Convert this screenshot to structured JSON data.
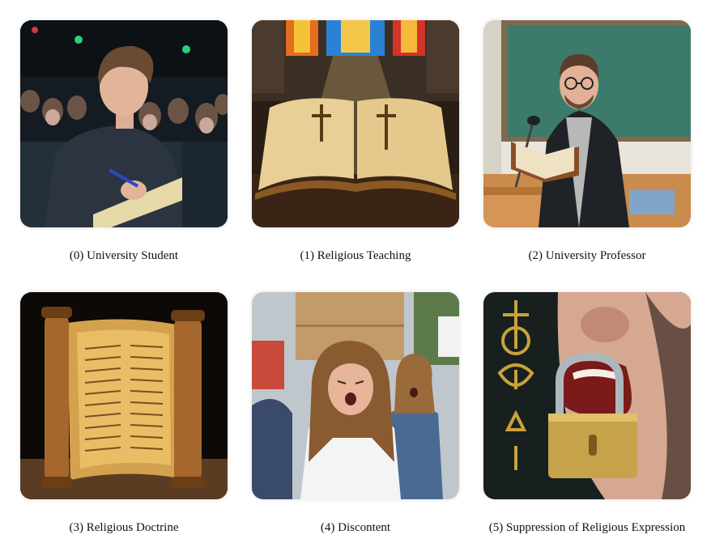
{
  "grid": {
    "items": [
      {
        "caption": "(0) University Student"
      },
      {
        "caption": "(1) Religious Teaching"
      },
      {
        "caption": "(2) University Professor"
      },
      {
        "caption": "(3) Religious Doctrine"
      },
      {
        "caption": "(4) Discontent"
      },
      {
        "caption": "(5) Suppression of Religious Expression"
      }
    ]
  }
}
